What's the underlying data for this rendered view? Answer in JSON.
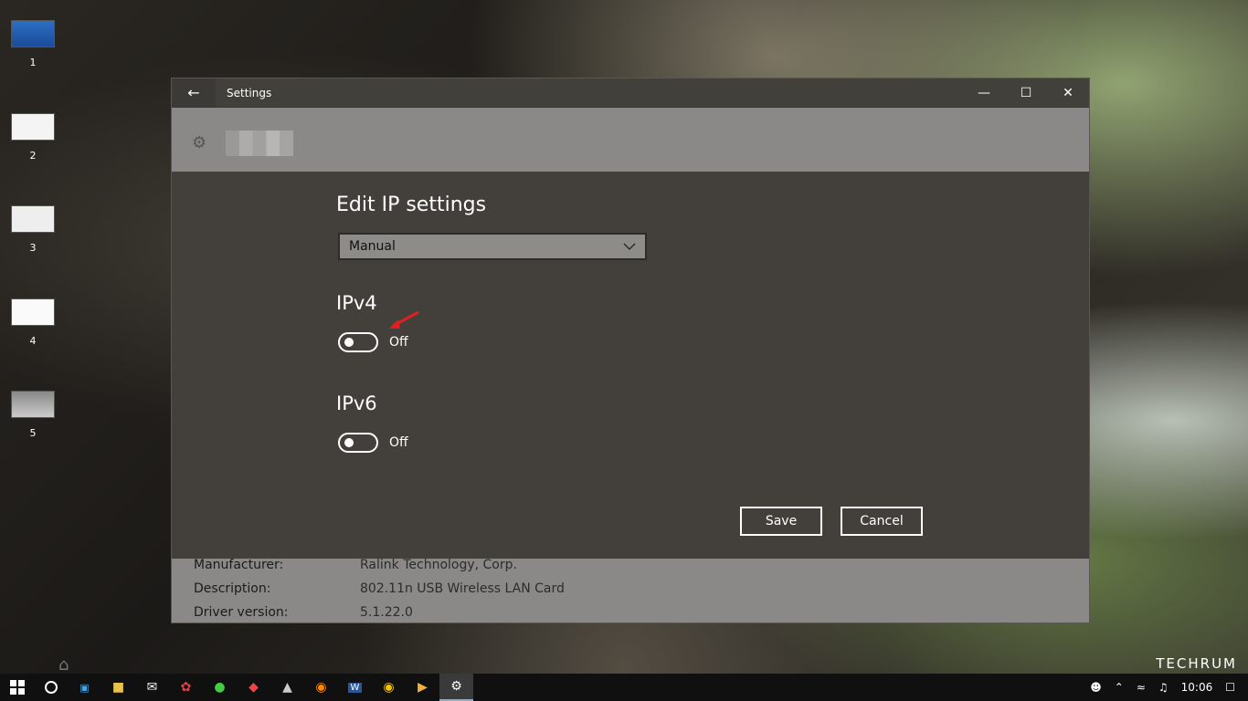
{
  "desktop": {
    "icons": [
      {
        "label": "1"
      },
      {
        "label": "2"
      },
      {
        "label": "3"
      },
      {
        "label": "4"
      },
      {
        "label": "5"
      }
    ]
  },
  "window": {
    "title": "Settings",
    "back_icon": "arrow-left-icon",
    "controls": {
      "minimize": "minimize-icon",
      "maximize": "maximize-icon",
      "close": "close-icon"
    }
  },
  "dialog": {
    "heading": "Edit IP settings",
    "dropdown": {
      "selected": "Manual",
      "icon": "chevron-down-icon"
    },
    "ipv4": {
      "title": "IPv4",
      "state": "Off"
    },
    "ipv6": {
      "title": "IPv6",
      "state": "Off"
    },
    "save_label": "Save",
    "cancel_label": "Cancel"
  },
  "properties": [
    {
      "key": "Manufacturer:",
      "value": "Ralink Technology, Corp."
    },
    {
      "key": "Description:",
      "value": "802.11n USB Wireless LAN Card"
    },
    {
      "key": "Driver version:",
      "value": "5.1.22.0"
    }
  ],
  "watermark": "TECHRUM",
  "taskbar": {
    "clock": "10:06",
    "items": [
      "start-icon",
      "cortana-icon",
      "app-icon",
      "file-explorer-icon",
      "mail-icon",
      "app-icon",
      "app-icon",
      "app-icon",
      "app-icon",
      "firefox-icon",
      "word-icon",
      "chrome-icon",
      "media-icon",
      "settings-icon"
    ]
  },
  "colors": {
    "accent": "#ffffff",
    "annotation_arrow": "#e0201e"
  }
}
